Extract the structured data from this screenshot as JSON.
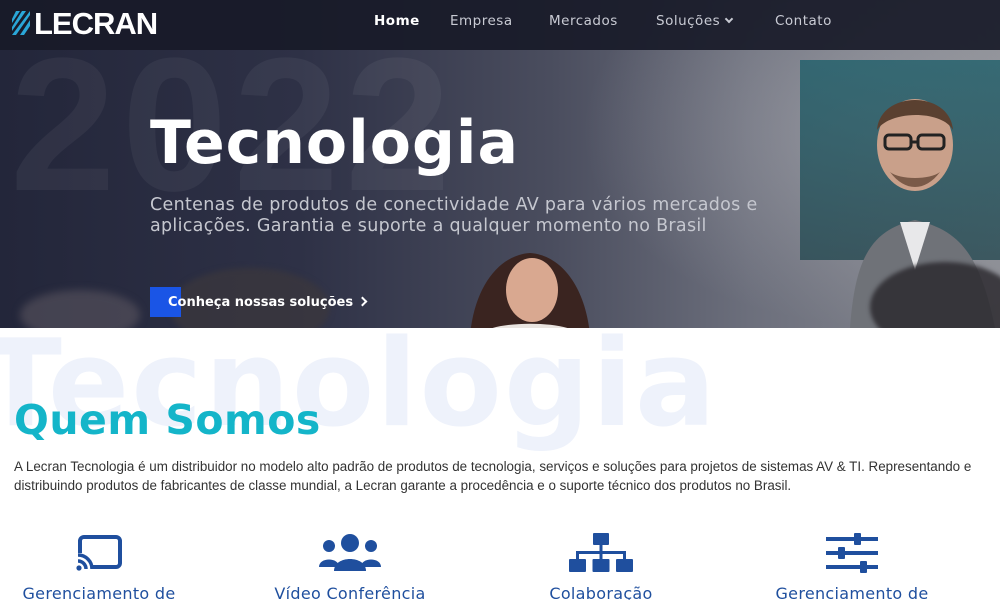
{
  "brand": {
    "logo_text": "LECRAN"
  },
  "nav": {
    "items": [
      {
        "label": "Home",
        "active": true
      },
      {
        "label": "Empresa",
        "active": false
      },
      {
        "label": "Mercados",
        "active": false
      },
      {
        "label": "Soluções",
        "active": false,
        "has_dropdown": true
      },
      {
        "label": "Contato",
        "active": false
      }
    ]
  },
  "hero": {
    "watermark": "2022",
    "title": "Tecnologia",
    "subtitle": "Centenas de produtos de conectividade AV para vários mercados e aplicações. Garantia e suporte a qualquer momento no Brasil",
    "cta_label": "Conheça nossas soluções"
  },
  "about": {
    "watermark": "Tecnologia",
    "title": "Quem Somos",
    "text": "A Lecran Tecnologia é um distribuidor no modelo alto padrão de produtos de tecnologia, serviços e soluções para projetos de sistemas AV & TI. Representando e distribuindo produtos de fabricantes de classe mundial, a Lecran garante a procedência e o suporte técnico dos produtos no Brasil."
  },
  "services": [
    {
      "label": "Gerenciamento de",
      "icon": "cast-icon"
    },
    {
      "label": "Vídeo Conferência",
      "icon": "users-icon"
    },
    {
      "label": "Colaboração",
      "icon": "sitemap-icon"
    },
    {
      "label": "Gerenciamento de",
      "icon": "sliders-icon"
    }
  ],
  "colors": {
    "accent": "#14b5c9",
    "cta": "#1a55e6",
    "service": "#1f4f9e",
    "nav_bg": "#181a28"
  }
}
